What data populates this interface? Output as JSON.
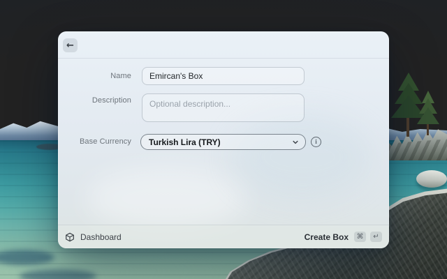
{
  "icons": {
    "back": "←",
    "info": "i"
  },
  "form": {
    "name": {
      "label": "Name",
      "value": "Emircan's Box"
    },
    "description": {
      "label": "Description",
      "placeholder": "Optional description..."
    },
    "base_currency": {
      "label": "Base Currency",
      "value": "Turkish Lira (TRY)"
    }
  },
  "footer": {
    "app_label": "Dashboard",
    "primary_action": "Create Box",
    "shortcut_keys": [
      "⌘",
      "↵"
    ]
  },
  "colors": {
    "sky_top": "#3c689f",
    "water_teal": "#3c9aa0",
    "window_tint": "#e6edf3",
    "text_primary": "#1d2126",
    "text_secondary": "#6d747b"
  }
}
